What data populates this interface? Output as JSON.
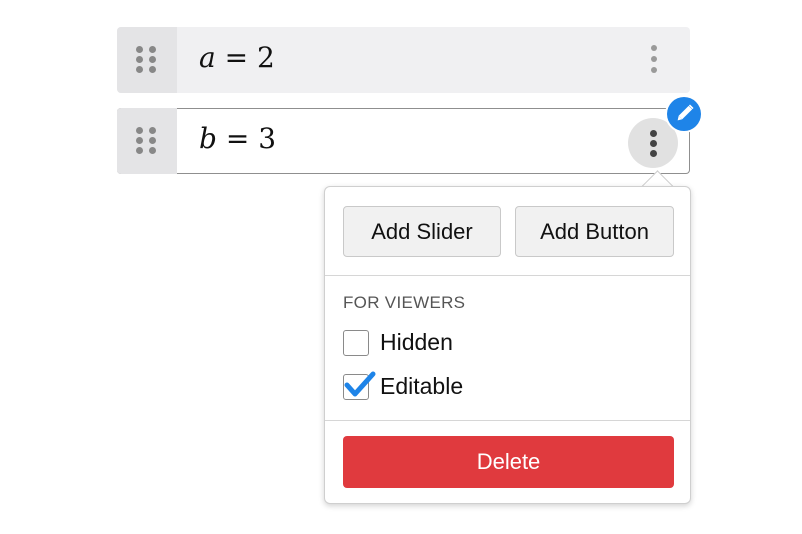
{
  "expressions": [
    {
      "variable": "a",
      "operator": "=",
      "value": "2"
    },
    {
      "variable": "b",
      "operator": "=",
      "value": "3"
    }
  ],
  "icons": {
    "drag_handle": "drag-handle-icon",
    "more_menu": "vertical-ellipsis-icon",
    "edit": "pencil-icon",
    "check": "checkmark-icon"
  },
  "menu": {
    "add_slider_label": "Add Slider",
    "add_button_label": "Add Button",
    "section_title": "FOR VIEWERS",
    "options": [
      {
        "label": "Hidden",
        "checked": false
      },
      {
        "label": "Editable",
        "checked": true
      }
    ],
    "delete_label": "Delete"
  },
  "colors": {
    "accent": "#1e84e8",
    "danger": "#e03a3e",
    "row_background": "#f0f0f2",
    "handle_background": "#e4e4e6"
  }
}
